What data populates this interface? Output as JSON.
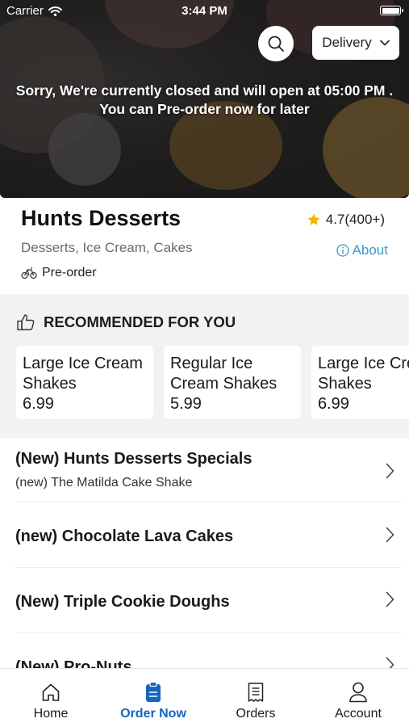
{
  "status_bar": {
    "carrier": "Carrier",
    "time": "3:44 PM"
  },
  "header": {
    "delivery_mode": "Delivery",
    "closed_message_line1": "Sorry, We're currently closed and will open at 05:00 PM .",
    "closed_message_line2": "You can Pre-order now for later"
  },
  "store": {
    "name": "Hunts Desserts",
    "rating": "4.7(400+)",
    "categories": "Desserts, Ice Cream, Cakes",
    "about_label": "About",
    "order_type": "Pre-order"
  },
  "recommended": {
    "heading": "RECOMMENDED FOR YOU",
    "items": [
      {
        "name": "Large Ice Cream Shakes",
        "price": "6.99"
      },
      {
        "name": "Regular Ice Cream Shakes",
        "price": "5.99"
      },
      {
        "name": "Large Ice Cream Shakes",
        "price": "6.99"
      }
    ]
  },
  "menu": {
    "categories": [
      {
        "title": "(New) Hunts Desserts Specials",
        "subtitle": "(new) The Matilda Cake Shake"
      },
      {
        "title": "(new) Chocolate Lava Cakes"
      },
      {
        "title": "(New) Triple Cookie Doughs"
      },
      {
        "title": "(New) Pro-Nuts"
      }
    ]
  },
  "tabs": [
    {
      "label": "Home"
    },
    {
      "label": "Order Now"
    },
    {
      "label": "Orders"
    },
    {
      "label": "Account"
    }
  ],
  "colors": {
    "accent": "#1565c0",
    "about_link": "#3a9bd0",
    "rating_star": "#f5b301"
  }
}
